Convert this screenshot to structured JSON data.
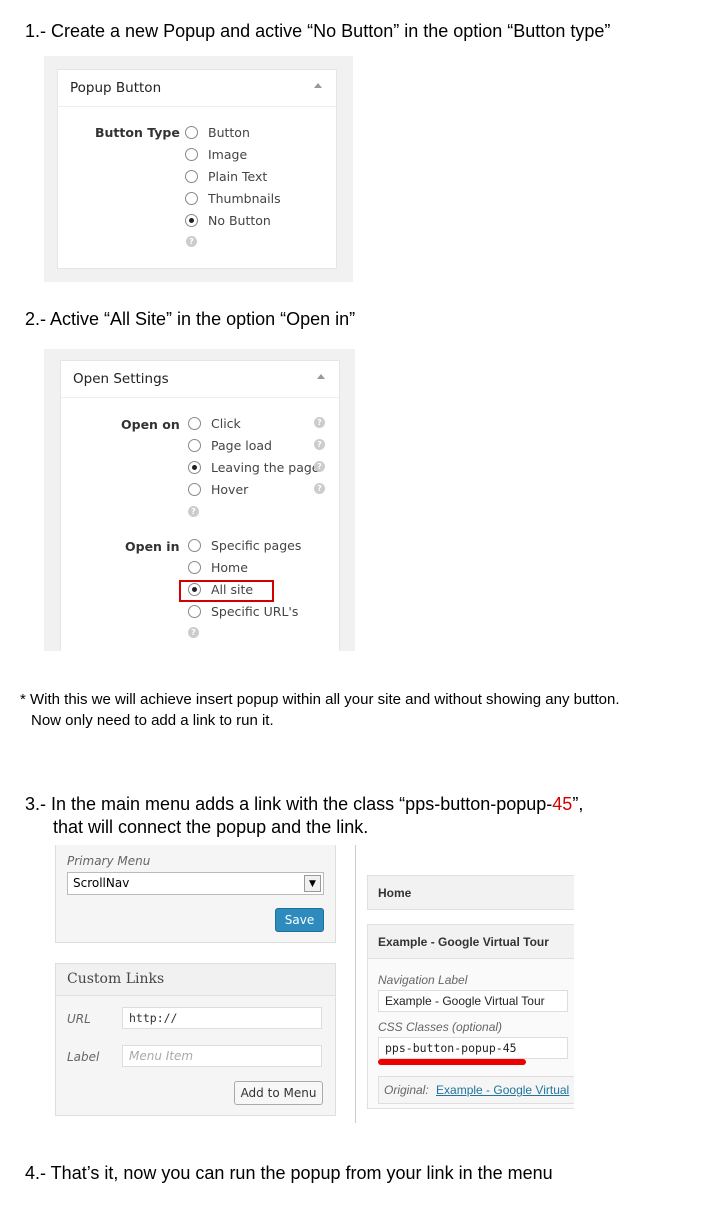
{
  "steps": {
    "s1": "1.- Create a new Popup and active “No Button” in the option “Button type”",
    "s2": "2.- Active “All Site” in the option “Open in”",
    "note_line1": "* With this we will achieve insert popup within all your site and without showing any button.",
    "note_line2": "Now only need to add a link to run it.",
    "s3_line1_a": "3.- In the main menu adds a link with the class “pps-button-popup-",
    "s3_line1_num": "45",
    "s3_line1_b": "”,",
    "s3_line2": "that will connect the popup and the link.",
    "s4": "4.- That’s it, now you can run the popup from your link in the menu"
  },
  "popup_button": {
    "title": "Popup Button",
    "label": "Button Type",
    "options": [
      "Button",
      "Image",
      "Plain Text",
      "Thumbnails",
      "No Button"
    ],
    "selected": "No Button"
  },
  "open_settings": {
    "title": "Open Settings",
    "open_on_label": "Open on",
    "open_on_options": [
      "Click",
      "Page load",
      "Leaving the page",
      "Hover"
    ],
    "open_on_selected": "Leaving the page",
    "open_in_label": "Open in",
    "open_in_options": [
      "Specific pages",
      "Home",
      "All site",
      "Specific URL's"
    ],
    "open_in_selected": "All site"
  },
  "menu_editor": {
    "primary_menu_label": "Primary Menu",
    "menu_select": "ScrollNav",
    "save_label": "Save",
    "custom_links_title": "Custom Links",
    "url_label": "URL",
    "url_value": "http://",
    "label_label": "Label",
    "label_placeholder": "Menu Item",
    "add_label": "Add to Menu",
    "home_item": "Home",
    "example_item": "Example - Google Virtual Tour",
    "nav_label_label": "Navigation Label",
    "nav_label_value": "Example - Google Virtual Tour",
    "css_label": "CSS Classes (optional)",
    "css_value": "pps-button-popup-45",
    "original_label": "Original:",
    "original_link": "Example - Google Virtual"
  },
  "colors": {
    "highlight": "#d40000",
    "primary_button": "#2e8bbd"
  }
}
